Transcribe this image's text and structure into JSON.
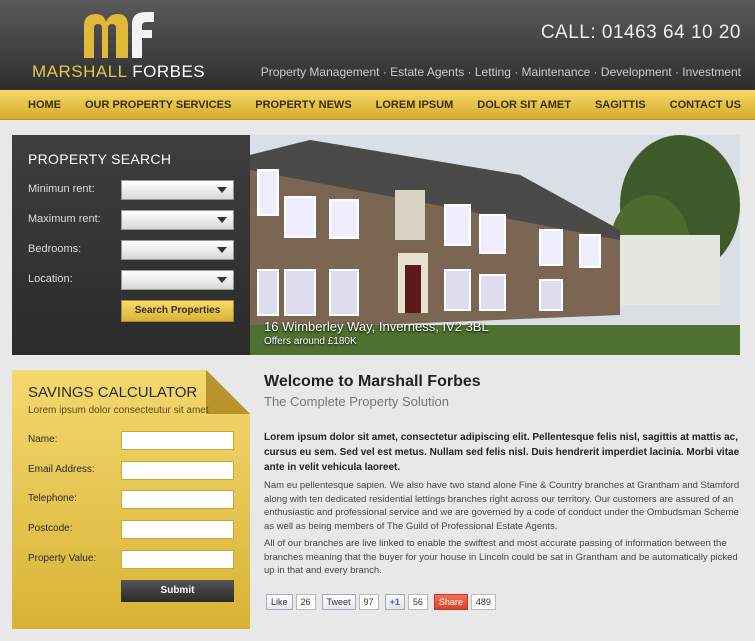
{
  "header": {
    "logo_mark": "mf",
    "logo_name_1": "MARSHALL",
    "logo_name_2": "FORBES",
    "phone": "CALL: 01463 64 10 20",
    "tagline": "Property Management · Estate Agents · Letting · Maintenance · Development · Investment"
  },
  "nav": [
    "HOME",
    "OUR PROPERTY SERVICES",
    "PROPERTY NEWS",
    "LOREM IPSUM",
    "DOLOR SIT AMET",
    "SAGITTIS",
    "CONTACT US"
  ],
  "search": {
    "title": "PROPERTY SEARCH",
    "fields": [
      "Minimun rent:",
      "Maximum rent:",
      "Bedrooms:",
      "Location:"
    ],
    "button": "Search Properties"
  },
  "hero": {
    "address": "16 Wimberley Way, Inverness, IV2 3BL",
    "price": "Offers around £180K"
  },
  "calculator": {
    "title": "SAVINGS CALCULATOR",
    "subtitle": "Lorem ipsum dolor consecteutur sit amet",
    "fields": [
      "Name:",
      "Email Address:",
      "Telephone:",
      "Postcode:",
      "Property Value:"
    ],
    "submit": "Submit"
  },
  "content": {
    "title": "Welcome to Marshall Forbes",
    "subtitle": "The Complete Property Solution",
    "lead": "Lorem ipsum dolor sit amet, consectetur adipiscing elit. Pellentesque felis nisl, sagittis at mattis ac, cursus eu sem. Sed vel est metus. Nullam sed felis nisl. Duis hendrerit imperdiet lacinia. Morbi vitae ante in velit vehicula laoreet.",
    "para1": "Nam eu pellentesque sapien. We also have two stand alone Fine & Country branches at Grantham and Stamford along with ten dedicated residential lettings branches right across our territory. Our customers are assured of an enthusiastic and professional service and we are governed by a code of conduct under the Ombudsman Scheme as well as being members of The Guild of Professional Estate Agents.",
    "para2": "All of our branches are live linked to enable the swiftest and most accurate passing of information between the branches meaning that the buyer for your house in Lincoln could be sat in Grantham and be automatically picked up in that and every branch."
  },
  "social": {
    "like": "Like",
    "like_count": "26",
    "tweet": "Tweet",
    "tweet_count": "97",
    "plus": "+1",
    "plus_count": "56",
    "share": "Share",
    "share_count": "489"
  },
  "colors": {
    "gold": "#e8c64a",
    "dark": "#2e2e2e",
    "nav_gold": "#d4ac2a"
  }
}
